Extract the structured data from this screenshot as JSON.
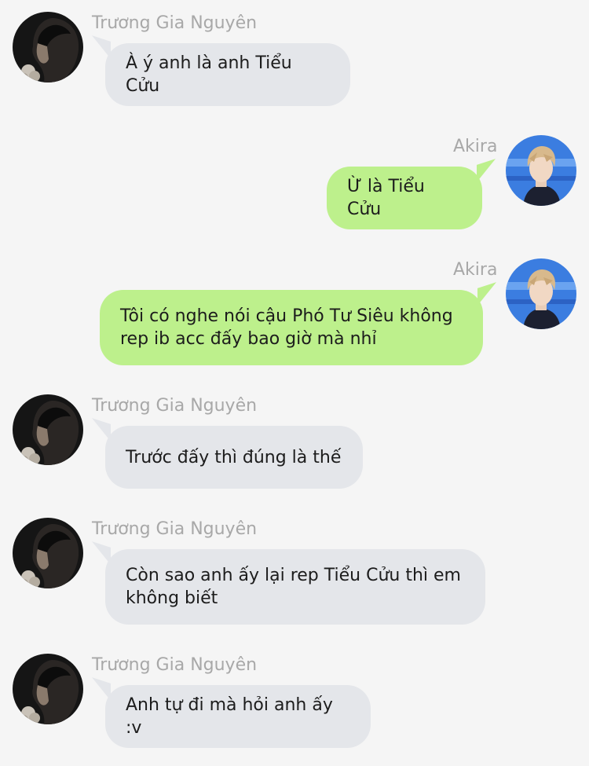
{
  "colors": {
    "background": "#f5f5f5",
    "incoming_bubble": "#e4e6ea",
    "outgoing_bubble": "#bdf08c",
    "sender_name": "#a8a8a8",
    "text": "#1c1c1c"
  },
  "messages": [
    {
      "direction": "incoming",
      "sender": "Trương Gia Nguyên",
      "avatar": "dark-portrait-avatar",
      "text": "À ý anh là anh Tiểu Cửu"
    },
    {
      "direction": "outgoing",
      "sender": "Akira",
      "avatar": "blond-portrait-avatar",
      "text": "Ừ là Tiểu Cửu"
    },
    {
      "direction": "outgoing",
      "sender": "Akira",
      "avatar": "blond-portrait-avatar",
      "text": "Tôi có nghe nói cậu Phó Tư Siêu không\nrep ib acc đấy bao giờ mà nhỉ"
    },
    {
      "direction": "incoming",
      "sender": "Trương Gia Nguyên",
      "avatar": "dark-portrait-avatar",
      "text": "Trước đấy thì đúng là thế"
    },
    {
      "direction": "incoming",
      "sender": "Trương Gia Nguyên",
      "avatar": "dark-portrait-avatar",
      "text": "Còn sao anh ấy lại rep Tiểu Cửu thì em\nkhông biết"
    },
    {
      "direction": "incoming",
      "sender": "Trương Gia Nguyên",
      "avatar": "dark-portrait-avatar",
      "text": "Anh tự đi mà hỏi anh ấy :v"
    }
  ]
}
